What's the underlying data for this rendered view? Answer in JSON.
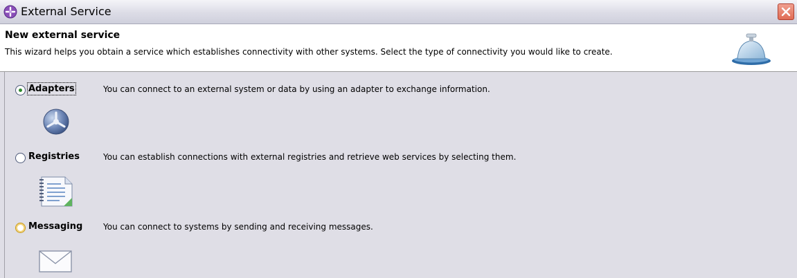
{
  "window": {
    "title": "External Service",
    "title_icon": "service-wizard-icon",
    "close_icon": "close-icon"
  },
  "header": {
    "title": "New external service",
    "description": "This wizard helps you obtain a service which establishes connectivity with other systems. Select the type of connectivity you would like to create.",
    "icon": "service-bell-icon"
  },
  "options": [
    {
      "label": "Adapters",
      "description": "You can connect to an external system or data by using an adapter to exchange information.",
      "selected": true,
      "icon": "adapter-icon"
    },
    {
      "label": "Registries",
      "description": "You can establish connections with external registries and retrieve web services by selecting them.",
      "selected": false,
      "icon": "registry-notebook-icon"
    },
    {
      "label": "Messaging",
      "description": "You can connect to systems by sending and receiving messages.",
      "selected": false,
      "icon": "envelope-icon"
    }
  ],
  "colors": {
    "dialog_background": "#dfdee6",
    "banner_background": "#ffffff",
    "radio_selected_dot": "#2f8a2f",
    "close_button": "#e06c54"
  }
}
